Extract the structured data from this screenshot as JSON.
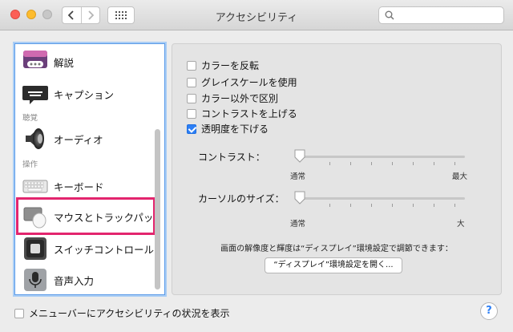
{
  "window": {
    "title": "アクセシビリティ",
    "search_placeholder": ""
  },
  "sidebar": {
    "items": [
      {
        "label": "解説",
        "icon": "speech-bubble-icon"
      },
      {
        "label": "キャプション",
        "icon": "captions-icon"
      },
      {
        "label": "オーディオ",
        "icon": "speaker-icon"
      },
      {
        "label": "キーボード",
        "icon": "keyboard-icon"
      },
      {
        "label": "マウスとトラックパッ",
        "icon": "mouse-trackpad-icon"
      },
      {
        "label": "スイッチコントロール",
        "icon": "switch-control-icon"
      },
      {
        "label": "音声入力",
        "icon": "microphone-icon"
      }
    ],
    "sections": {
      "hearing": "聴覚",
      "interaction": "操作"
    }
  },
  "display": {
    "checkboxes": [
      {
        "label": "カラーを反転",
        "checked": false
      },
      {
        "label": "グレイスケールを使用",
        "checked": false
      },
      {
        "label": "カラー以外で区別",
        "checked": false
      },
      {
        "label": "コントラストを上げる",
        "checked": false
      },
      {
        "label": "透明度を下げる",
        "checked": true
      }
    ],
    "contrast": {
      "label": "コントラスト：",
      "min_label": "通常",
      "max_label": "最大",
      "value": 0
    },
    "cursor_size": {
      "label": "カーソルのサイズ：",
      "min_label": "通常",
      "max_label": "大",
      "value": 0
    },
    "info_text": "画面の解像度と輝度は“ディスプレイ”環境設定で調節できます：",
    "open_display_button": "“ディスプレイ”環境設定を開く..."
  },
  "footer": {
    "menubar_checkbox_label": "メニューバーにアクセシビリティの状況を表示",
    "menubar_checked": false,
    "help_label": "?"
  },
  "colors": {
    "accent": "#2d7ff5",
    "highlight": "#e3256e"
  }
}
